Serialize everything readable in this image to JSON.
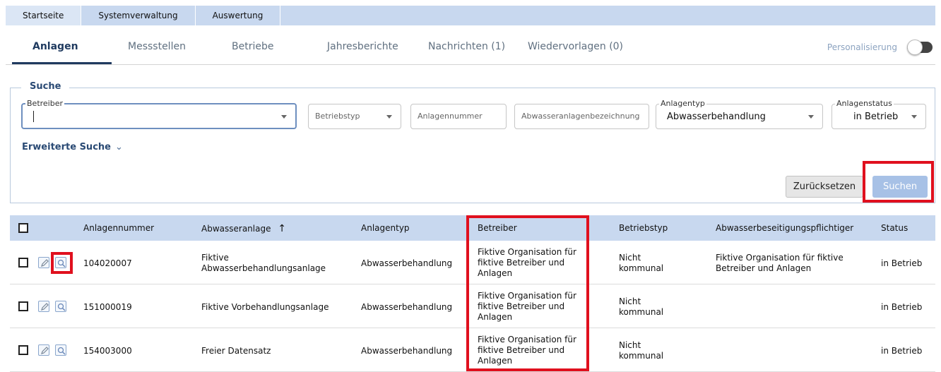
{
  "topmenu": [
    "Startseite",
    "Systemverwaltung",
    "Auswertung"
  ],
  "tabs": [
    "Anlagen",
    "Messstellen",
    "Betriebe",
    "Jahresberichte",
    "Nachrichten (1)",
    "Wiedervorlagen (0)"
  ],
  "personalization_label": "Personalisierung",
  "search": {
    "title": "Suche",
    "betreiber_label": "Betreiber",
    "betriebstyp_placeholder": "Betriebstyp",
    "anlagennummer_placeholder": "Anlagennummer",
    "bezeichnung_placeholder": "Abwasseranlagenbezeichnung",
    "anlagentyp_label": "Anlagentyp",
    "anlagentyp_value": "Abwasserbehandlung",
    "status_label": "Anlagenstatus",
    "status_value": "in Betrieb",
    "advanced_label": "Erweiterte Suche",
    "reset_label": "Zurücksetzen",
    "search_label": "Suchen"
  },
  "table": {
    "headers": [
      "Anlagennummer",
      "Abwasseranlage",
      "Anlagentyp",
      "Betreiber",
      "Betriebstyp",
      "Abwasserbeseitigungspflichtiger",
      "Status"
    ],
    "sort_glyph": "↑",
    "rows": [
      {
        "nummer": "104020007",
        "anlage": "Fiktive Abwasserbehandlungsanlage",
        "typ": "Abwasserbehandlung",
        "betreiber": "Fiktive Organisation für fiktive Betreiber und Anlagen",
        "betriebstyp": "Nicht kommunal",
        "pflichtiger": "Fiktive Organisation für fiktive Betreiber und Anlagen",
        "status": "in Betrieb"
      },
      {
        "nummer": "151000019",
        "anlage": "Fiktive Vorbehandlungsanlage",
        "typ": "Abwasserbehandlung",
        "betreiber": "Fiktive Organisation für fiktive Betreiber und Anlagen",
        "betriebstyp": "Nicht kommunal",
        "pflichtiger": "",
        "status": "in Betrieb"
      },
      {
        "nummer": "154003000",
        "anlage": "Freier Datensatz",
        "typ": "Abwasserbehandlung",
        "betreiber": "Fiktive Organisation für fiktive Betreiber und Anlagen",
        "betriebstyp": "Nicht kommunal",
        "pflichtiger": "",
        "status": "in Betrieb"
      }
    ]
  },
  "colors": {
    "highlight": "#e0101e",
    "header_bg": "#c8d8ef",
    "accent": "#1f3a5f"
  }
}
